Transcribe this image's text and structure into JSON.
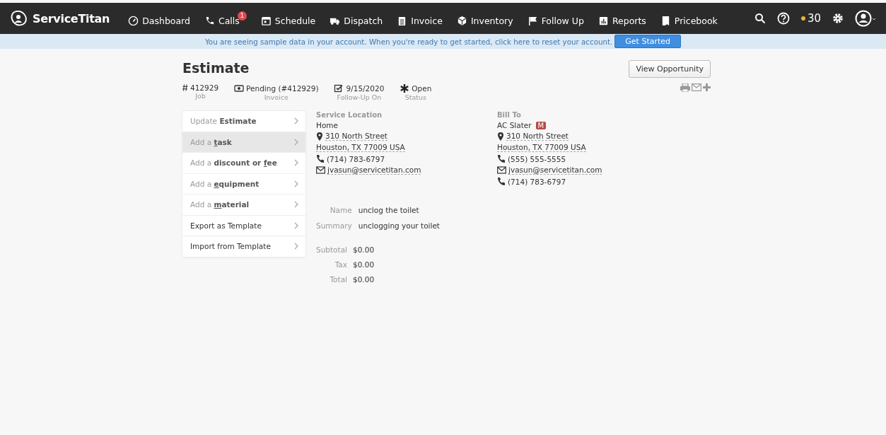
{
  "brand": {
    "name": "ServiceTitan"
  },
  "nav": [
    {
      "label": "Dashboard"
    },
    {
      "label": "Calls",
      "badge": "1"
    },
    {
      "label": "Schedule"
    },
    {
      "label": "Dispatch"
    },
    {
      "label": "Invoice"
    },
    {
      "label": "Inventory"
    },
    {
      "label": "Follow Up"
    },
    {
      "label": "Reports"
    },
    {
      "label": "Pricebook"
    }
  ],
  "points": "30",
  "banner": {
    "message": "You are seeing sample data in your account. When you're ready to get started, click here to reset your account.",
    "button": "Get Started"
  },
  "page": {
    "title": "Estimate",
    "action_button": "View Opportunity"
  },
  "meta": [
    {
      "value": "412929",
      "label": "Job"
    },
    {
      "value": "Pending (#412929)",
      "label": "Invoice"
    },
    {
      "value": "9/15/2020",
      "label": "Follow-Up On"
    },
    {
      "value": "Open",
      "label": "Status"
    }
  ],
  "menu": [
    {
      "kind": "action",
      "lead": "Update",
      "action_start": "Estimate",
      "hovered": false
    },
    {
      "kind": "action",
      "lead": "Add a",
      "key": "t",
      "action_end": "ask",
      "hovered": true
    },
    {
      "kind": "action",
      "lead": "Add a",
      "action_start": "discount or ",
      "key": "f",
      "action_end": "ee",
      "hovered": false
    },
    {
      "kind": "action",
      "lead": "Add a",
      "key": "e",
      "action_end": "quipment",
      "hovered": false
    },
    {
      "kind": "action",
      "lead": "Add a",
      "key": "m",
      "action_end": "aterial",
      "hovered": false
    },
    {
      "kind": "plain",
      "action_start": "Export as Template",
      "hovered": false
    },
    {
      "kind": "plain",
      "action_start": "Import from Template",
      "hovered": false
    }
  ],
  "service_location": {
    "heading": "Service Location",
    "lines": [
      {
        "kind": "text",
        "text": "Home",
        "link": false
      },
      {
        "kind": "address",
        "text": "310 North Street",
        "link": true
      },
      {
        "kind": "text",
        "text": "Houston, TX 77009 USA",
        "link": true
      },
      {
        "kind": "phone",
        "text": "(714) 783-6797",
        "link": false
      },
      {
        "kind": "email",
        "text": "jvasun@servicetitan.com",
        "link": true
      }
    ]
  },
  "bill_to": {
    "heading": "Bill To",
    "name": "AC Slater",
    "tag": "M",
    "lines": [
      {
        "kind": "address",
        "text": "310 North Street",
        "link": true
      },
      {
        "kind": "text",
        "text": "Houston, TX 77009 USA",
        "link": true
      },
      {
        "kind": "phone",
        "text": "(555) 555-5555",
        "link": false
      },
      {
        "kind": "email",
        "text": "jvasun@servicetitan.com",
        "link": true
      },
      {
        "kind": "phone",
        "text": "(714) 783-6797",
        "link": false
      }
    ]
  },
  "details": [
    {
      "label": "Name",
      "value": "unclog the toilet"
    },
    {
      "label": "Summary",
      "value": "unclogging your toilet"
    }
  ],
  "totals": [
    {
      "label": "Subtotal",
      "value": "$0.00"
    },
    {
      "label": "Tax",
      "value": "$0.00"
    },
    {
      "label": "Total",
      "value": "$0.00"
    }
  ]
}
